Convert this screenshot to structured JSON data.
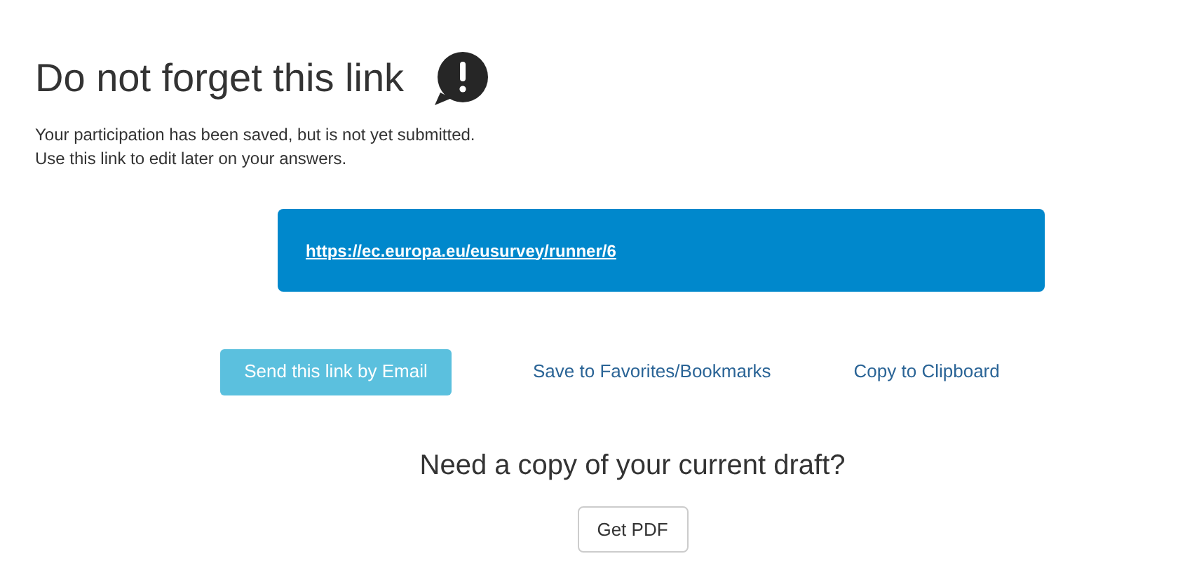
{
  "title": "Do not forget this link",
  "message": [
    "Your participation has been saved, but is not yet submitted.",
    "Use this link to edit later on your answers."
  ],
  "link": "https://ec.europa.eu/eusurvey/runner/6",
  "actions": [
    {
      "kind": "button",
      "label": "Send this link by Email"
    },
    {
      "kind": "link",
      "label": "Save to Favorites/Bookmarks"
    },
    {
      "kind": "link",
      "label": "Copy to Clipboard"
    }
  ],
  "draft": {
    "heading": "Need a copy of your current draft?",
    "button": "Get PDF"
  }
}
